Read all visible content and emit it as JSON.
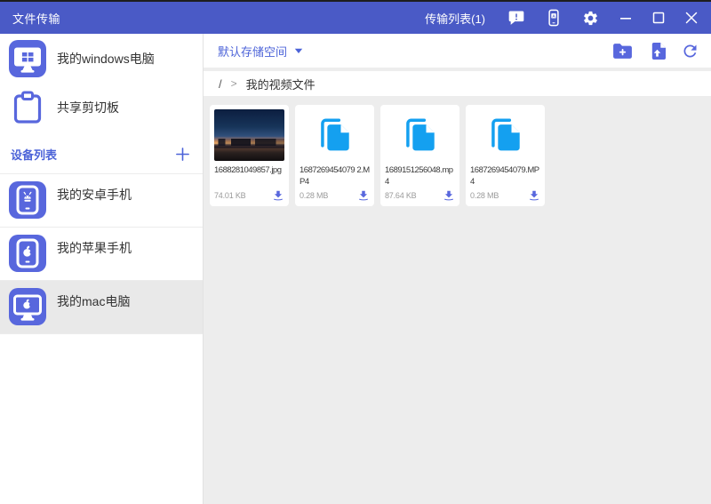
{
  "titlebar": {
    "title": "文件传输",
    "transfer_list_label": "传输列表(1)"
  },
  "sidebar": {
    "computer": {
      "label": "我的windows电脑"
    },
    "clipboard": {
      "label": "共享剪切板"
    },
    "device_section": {
      "label": "设备列表"
    },
    "devices": [
      {
        "label": "我的安卓手机",
        "type": "android-phone",
        "selected": false
      },
      {
        "label": "我的苹果手机",
        "type": "apple-phone",
        "selected": false
      },
      {
        "label": "我的mac电脑",
        "type": "mac-computer",
        "selected": true
      }
    ]
  },
  "toolbar": {
    "storage_label": "默认存储空间"
  },
  "breadcrumb": {
    "root": "/",
    "separator": ">",
    "current": "我的视频文件"
  },
  "files": [
    {
      "name": "1688281049857.jpg",
      "size": "74.01 KB",
      "kind": "image"
    },
    {
      "name": "1687269454079 2.MP4",
      "size": "0.28 MB",
      "kind": "video"
    },
    {
      "name": "1689151256048.mp4",
      "size": "87.64 KB",
      "kind": "video"
    },
    {
      "name": "1687269454079.MP4",
      "size": "0.28 MB",
      "kind": "video"
    }
  ],
  "icons": {
    "titlebar": [
      "feedback-bubble",
      "phone-a",
      "settings-gear",
      "minimize",
      "maximize",
      "close"
    ],
    "toolbar": [
      "new-folder",
      "upload-file",
      "refresh"
    ],
    "card": [
      "copy-file",
      "download"
    ]
  },
  "colors": {
    "titlebar_bg": "#4a5ac6",
    "accent": "#5867dd",
    "accent_text": "#4c63d8",
    "file_icon_blue": "#14a0f0",
    "main_bg": "#ededed",
    "selected_row_bg": "#e9e9e9"
  }
}
